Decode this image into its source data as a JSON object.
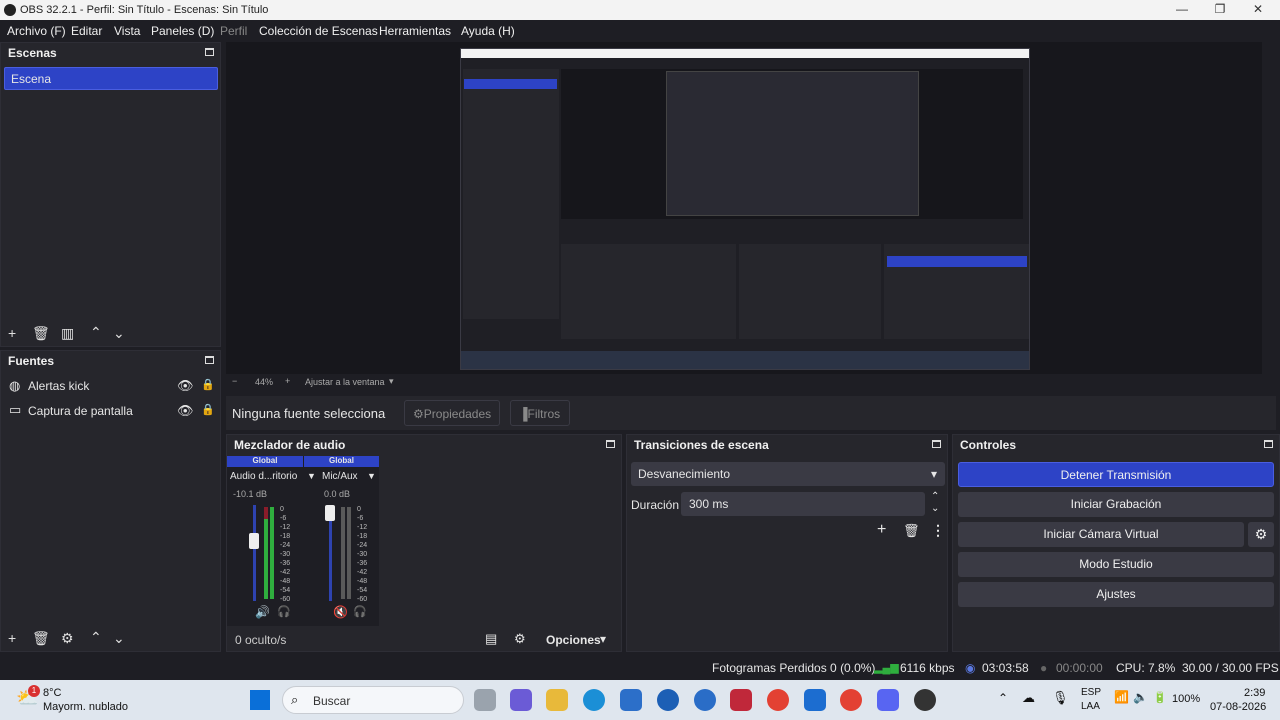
{
  "window": {
    "title": "OBS 32.2.1 - Perfil: Sin Título - Escenas: Sin Título"
  },
  "menu": [
    "Archivo (F)",
    "Editar",
    "Vista",
    "Paneles (D)",
    "Perfil",
    "Colección de Escenas",
    "Herramientas",
    "Ayuda (H)"
  ],
  "scenes": {
    "title": "Escenas",
    "items": [
      "Escena"
    ]
  },
  "sources": {
    "title": "Fuentes",
    "items": [
      "Alertas kick",
      "Captura de pantalla"
    ]
  },
  "preview": {
    "zoom": "44%",
    "fit_label": "Ajustar a la ventana"
  },
  "context": {
    "no_source": "Ninguna fuente selecciona",
    "properties": "Propiedades",
    "filters": "Filtros"
  },
  "mixer": {
    "title": "Mezclador de audio",
    "channels": [
      {
        "global": "Global",
        "name": "Audio d...ritorio",
        "db": "-10.1 dB"
      },
      {
        "global": "Global",
        "name": "Mic/Aux",
        "db": "0.0 dB"
      }
    ],
    "scale": [
      "0",
      "-6",
      "-12",
      "-18",
      "-24",
      "-30",
      "-36",
      "-42",
      "-48",
      "-54",
      "-60"
    ],
    "hidden": "0 oculto/s",
    "options": "Opciones"
  },
  "transitions": {
    "title": "Transiciones de escena",
    "selected": "Desvanecimiento",
    "duration_label": "Duración",
    "duration_value": "300 ms"
  },
  "controls": {
    "title": "Controles",
    "buttons": [
      "Detener Transmisión",
      "Iniciar Grabación",
      "Iniciar Cámara Virtual",
      "Modo Estudio",
      "Ajustes"
    ]
  },
  "status": {
    "dropped": "Fotogramas Perdidos 0 (0.0%)",
    "kbps": "6116 kbps",
    "stream_time": "03:03:58",
    "rec_time": "00:00:00",
    "cpu": "CPU: 7.8%",
    "fps": "30.00 / 30.00 FPS"
  },
  "taskbar": {
    "temp": "8°C",
    "weather": "Mayorm. nublado",
    "badge": "1",
    "search": "Buscar",
    "lang1": "ESP",
    "lang2": "LAA",
    "battery": "100%",
    "time": "2:39",
    "date": "07-08-2026"
  },
  "colors": {
    "accent": "#2d43c6",
    "bg": "#1e1e24",
    "dock": "#26262c"
  }
}
